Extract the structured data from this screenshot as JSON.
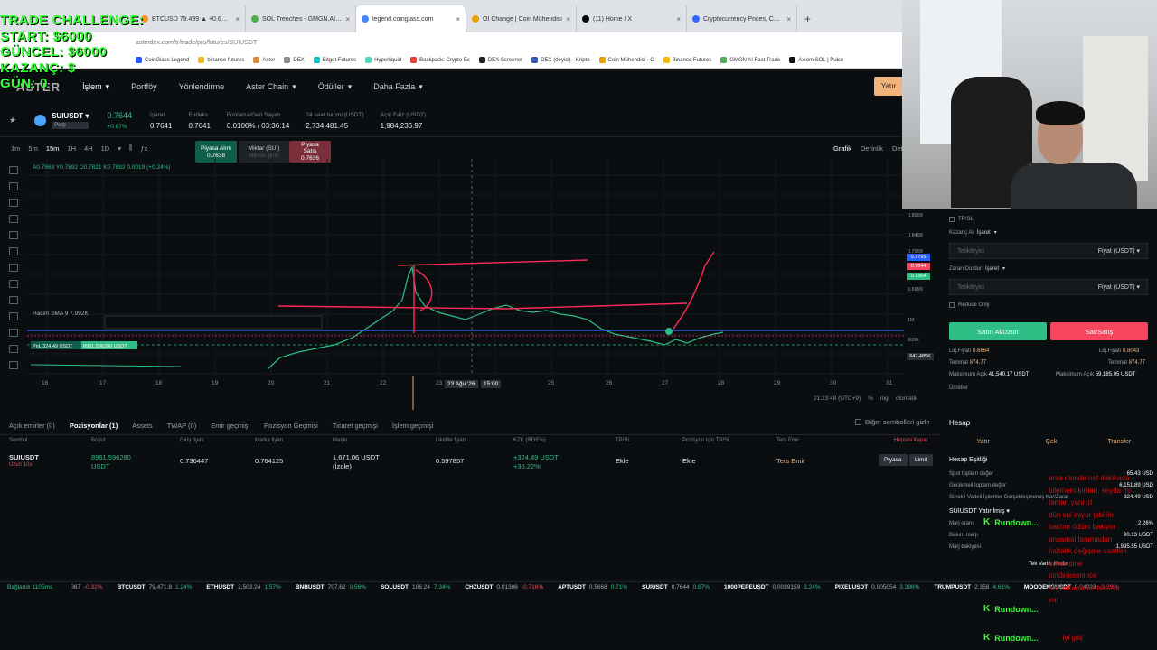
{
  "overlay": {
    "line1": "TRADE CHALLENGE:",
    "line2": "START: $6000",
    "line3": "GÜNCEL: $6000",
    "line4": "KAZANÇ: $",
    "line5": "GÜN: 0"
  },
  "browser": {
    "tabs": [
      {
        "title": "BTCUSD 79.499 ▲ +0.6% Unnu",
        "color": "#f7931a"
      },
      {
        "title": "SOL Trenches - GMGN.AI | The",
        "color": "#4caf50"
      },
      {
        "title": "legend.coinglass.com",
        "color": "#4488ff"
      },
      {
        "title": "OI Change | Coin Mühendisi",
        "color": "#e6a100"
      },
      {
        "title": "(11) Home / X",
        "color": "#000000"
      },
      {
        "title": "Cryptocurrency Prices, Charts A",
        "color": "#3366ff"
      }
    ],
    "new_tab": "+",
    "address": "asterdex.com/tr/trade/pro/futures/SUIUSDT",
    "bookmarks": [
      {
        "label": "CoinGlass Legend",
        "color": "#2255ff"
      },
      {
        "label": "binance futures",
        "color": "#f0b90b"
      },
      {
        "label": "Aster",
        "color": "#d88a3a"
      },
      {
        "label": "DEX",
        "color": "#888888"
      },
      {
        "label": "Bitget Futures",
        "color": "#00c2c2"
      },
      {
        "label": "Hyperliquid",
        "color": "#55d6be"
      },
      {
        "label": "Backpack: Crypto Ex",
        "color": "#e33e3e"
      },
      {
        "label": "DEX Screener",
        "color": "#222222"
      },
      {
        "label": "DEX (deyici) - Kripto",
        "color": "#3355aa"
      },
      {
        "label": "Coin Mühendisi - C",
        "color": "#e6a100"
      },
      {
        "label": "Binance Futures",
        "color": "#f0b90b"
      },
      {
        "label": "GMGN AI Fast Trade",
        "color": "#4caf50"
      },
      {
        "label": "Axiom SOL | Pulse",
        "color": "#111111"
      }
    ]
  },
  "nav": {
    "logo": "ASTER",
    "items": [
      "İşlem",
      "Portföy",
      "Yönlendirme",
      "Aster Chain",
      "Ödüller",
      "Daha Fazla"
    ],
    "deposit": "Yatır"
  },
  "ticker": {
    "symbol": "SUIUSDT",
    "badge": "Perp",
    "price": "0.7644",
    "change": "+0.87%",
    "stats": [
      {
        "label": "İşaret",
        "value": "0.7641"
      },
      {
        "label": "Endeks",
        "value": "0.7641"
      },
      {
        "label": "Fonlama/Geri Sayım",
        "value": "0.0100% / 03:36:14"
      },
      {
        "label": "24 saat hacmi (USDT)",
        "value": "2,734,481.45"
      },
      {
        "label": "Açık Faiz (USDT)",
        "value": "1,984,236.97"
      }
    ]
  },
  "chart_toolbar": {
    "intervals": [
      "1m",
      "5m",
      "15m",
      "1H",
      "4H",
      "1D"
    ],
    "active": "15m",
    "buy_label": "Piyasa Alım",
    "buy_price": "0.7638",
    "mid_label": "Miktar (SUI)",
    "mid_hint": "Miktarı girin",
    "sell_label": "Piyasa Satış",
    "sell_price": "0.7636",
    "views": [
      "Grafik",
      "Derinlik",
      "Det"
    ]
  },
  "chart": {
    "ohlc": "A0.7863 Y0.7892 D0.7821 K0.7892 0.0019 (+0.24%)",
    "volume_label": "Hacim SMA 9  7.992K",
    "position_tag": "PnL 324.49 USDT",
    "position_size": "8961.596280 USDT",
    "x_labels": [
      "16",
      "17",
      "18",
      "19",
      "20",
      "21",
      "22",
      "23",
      "25",
      "26",
      "27",
      "28",
      "29",
      "30",
      "31"
    ],
    "crosshair_date": "23 Ağu '26",
    "crosshair_time": "15:00",
    "axis_right": [
      "0.8999",
      "0.8499",
      "0.7999",
      "0.6999",
      "1M",
      "800K"
    ],
    "tag_top": "0.7795",
    "tag_price": "0.7644",
    "tag_entry": "0.7364",
    "tag_vol": "647.485K",
    "clock": "21:23:48 (UTC+9)",
    "pct": "%",
    "log": "log",
    "auto": "otomatik"
  },
  "positions": {
    "tabs": [
      "Açık emirler (0)",
      "Pozisyonlar (1)",
      "Assets",
      "TWAP (0)",
      "Emir geçmişi",
      "Pozisyon Geçmişi",
      "Ticaret geçmişi",
      "İşlem geçmişi"
    ],
    "active_tab": "Pozisyonlar (1)",
    "hide_other": "Diğer sembolleri gizle",
    "headers": [
      "Sembol",
      "Boyut",
      "Giriş fiyatı",
      "Marka fiyatı",
      "Marjin",
      "Likidite fiyatı",
      "KZK (ROE%)",
      "TP/SL",
      "Pozisyon için TP/SL",
      "Ters Emir",
      "Hepsini Kapat"
    ],
    "row": {
      "symbol": "SUIUSDT",
      "side": "Uzun 10x",
      "size": "8961.596280",
      "size_unit": "USDT",
      "entry": "0.736447",
      "mark": "0.764125",
      "margin": "1,671.06 USDT",
      "margin_mode": "(İzole)",
      "liq": "0.597857",
      "pnl": "+324.49 USDT",
      "roe": "+36.22%",
      "tpsl": "Ekle",
      "pos_tpsl": "Ekle",
      "reverse": "Ters Emir",
      "market": "Piyasa",
      "limit": "Limit"
    }
  },
  "footer": {
    "status": "Bağlandı 1105ms",
    "items": [
      {
        "sym": "",
        "price": "067",
        "chg": "-0.32%",
        "up": false
      },
      {
        "sym": "BTCUSDT",
        "price": "79,471.8",
        "chg": "1.24%",
        "up": true
      },
      {
        "sym": "ETHUSDT",
        "price": "2,503.24",
        "chg": "1.57%",
        "up": true
      },
      {
        "sym": "BNBUSDT",
        "price": "707.62",
        "chg": "0.56%",
        "up": true
      },
      {
        "sym": "SOLUSDT",
        "price": "106.24",
        "chg": "7.34%",
        "up": true
      },
      {
        "sym": "CHZUSDT",
        "price": "0.01386",
        "chg": "-0.716%",
        "up": false
      },
      {
        "sym": "APTUSDT",
        "price": "0.5668",
        "chg": "0.71%",
        "up": true
      },
      {
        "sym": "SUIUSDT",
        "price": "0.7644",
        "chg": "0.87%",
        "up": true
      },
      {
        "sym": "1000PEPEUSDT",
        "price": "0.0039159",
        "chg": "3.24%",
        "up": true
      },
      {
        "sym": "PIXELUSDT",
        "price": "0.005054",
        "chg": "3.396%",
        "up": true
      },
      {
        "sym": "TRUMPUSDT",
        "price": "2.358",
        "chg": "4.61%",
        "up": true
      },
      {
        "sym": "MOODENGUSDT",
        "price": "0.04093",
        "chg": "-3.29%",
        "up": false
      }
    ]
  },
  "order_panel": {
    "tpsl": "TP/SL",
    "tp_label": "Kazanç Al",
    "tp_mode": "İşaret",
    "tp_placeholder": "Tetikleyici",
    "price_unit": "Fiyat (USDT)",
    "sl_label": "Zararı Durdur",
    "sl_mode": "İşaret",
    "sl_placeholder": "Tetikleyici",
    "reduce_only": "Reduce Only",
    "buy": "Satın Al/Uzun",
    "sell": "Sat/Satış",
    "buy_liq_label": "Liq.Fiyatı",
    "buy_liq": "0.6664",
    "sell_liq_label": "Liq.Fiyatı",
    "sell_liq": "0.8043",
    "buy_cost_label": "Teminat",
    "buy_cost": "874.77",
    "sell_cost_label": "Teminat",
    "sell_cost": "874.77",
    "buy_max_label": "Maksimum Açık",
    "buy_max": "41,540.17 USDT",
    "sell_max_label": "Maksimum Açık",
    "sell_max": "59,185.05 USDT",
    "fees": "Ücretler"
  },
  "account": {
    "title": "Hesap",
    "tabs": [
      "Yatır",
      "Çek",
      "Transfer"
    ],
    "equity_title": "Hesap Eşitliği",
    "lines": [
      {
        "label": "Spot toplam değer",
        "value": "65.43 USD"
      },
      {
        "label": "Gecikmeli toplam değer",
        "value": "6,151.89 USD"
      },
      {
        "label": "Sürekli Vadeli İşlemler Gerçekleşmemiş Kar/Zarar",
        "value": "324.49 USD"
      }
    ],
    "margin_title": "SUIUSDT Yatırılmış",
    "margin_lines": [
      {
        "label": "Marj oranı",
        "value": "2.26%"
      },
      {
        "label": "Bakım marjı",
        "value": "90.13 USDT"
      },
      {
        "label": "Marj bakiyesi",
        "value": "1,995.55 USDT"
      }
    ],
    "single_mode": "Tek Varlık Modu"
  },
  "chat": {
    "lines": [
      "arsa olunda net dakikada",
      "bilemem kırılan, seyda mı",
      "taman yani :d",
      "dün sui iniyor gibi ile",
      "baktım ödüm bakiyor",
      "anasmal tanımadan",
      "haftalık değişme saatten",
      "adres dine",
      "pindinesenince",
      "abi mikaelinde bi ozeti",
      "var"
    ],
    "users": [
      {
        "name": "Rundown...",
        "msg": ""
      },
      {
        "name": "Rundown...",
        "msg": ""
      },
      {
        "name": "Rundown...",
        "msg": "iyi gitti"
      }
    ]
  },
  "colors": {
    "green": "#2ebd85",
    "red": "#f6465d",
    "accent": "#f0b47a",
    "overlay": "#33ff33",
    "annotation": "#ff2a55"
  }
}
